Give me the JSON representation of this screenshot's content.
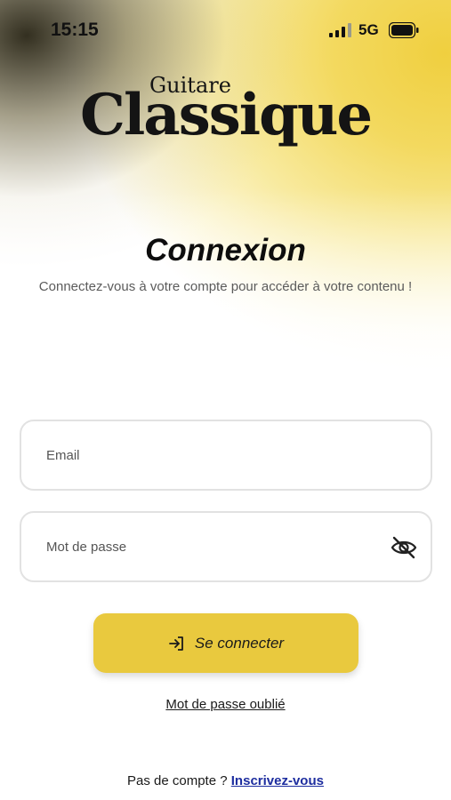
{
  "status_bar": {
    "time": "15:15",
    "network": "5G",
    "icons": [
      "signal-icon",
      "battery-icon"
    ]
  },
  "logo": {
    "top_text": "Guitare",
    "main_text": "Classique"
  },
  "header": {
    "title": "Connexion",
    "subtitle": "Connectez-vous à votre compte pour accéder à votre contenu !"
  },
  "form": {
    "email_placeholder": "Email",
    "password_placeholder": "Mot de passe",
    "password_toggle_icon": "eye-off-icon"
  },
  "actions": {
    "login_label": "Se connecter",
    "login_icon": "login-arrow-icon",
    "forgot_password": "Mot de passe oublié",
    "no_account": "Pas de compte ?",
    "signup_link": "Inscrivez-vous"
  },
  "colors": {
    "accent": "#e9c93e",
    "link": "#1d2d9f"
  }
}
